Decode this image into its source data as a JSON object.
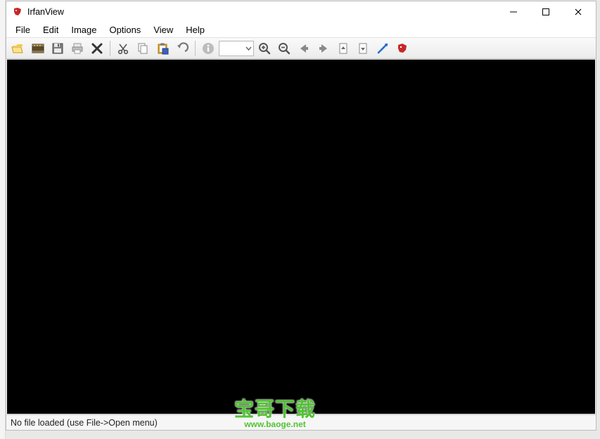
{
  "titlebar": {
    "title": "IrfanView"
  },
  "menubar": {
    "items": [
      "File",
      "Edit",
      "Image",
      "Options",
      "View",
      "Help"
    ]
  },
  "toolbar": {
    "zoom_value": ""
  },
  "statusbar": {
    "text": "No file loaded (use File->Open menu)"
  },
  "watermark": {
    "line1": "宝哥下载",
    "line2": "www.baoge.net"
  }
}
